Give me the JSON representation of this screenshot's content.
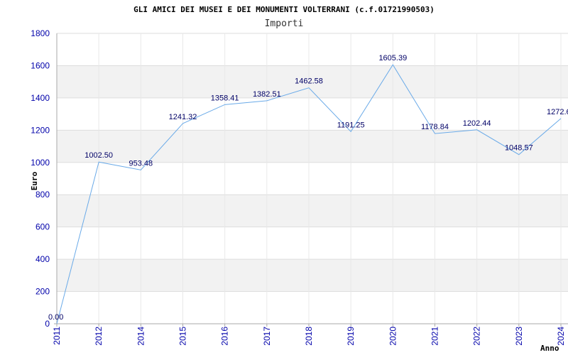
{
  "chart_data": {
    "type": "line",
    "title": "GLI AMICI DEI MUSEI E DEI MONUMENTI VOLTERRANI (c.f.01721990503)",
    "subtitle": "Importi",
    "xlabel": "Anno",
    "ylabel": "Euro",
    "ylim": [
      0,
      1800
    ],
    "yticks": [
      0,
      200,
      400,
      600,
      800,
      1000,
      1200,
      1400,
      1600,
      1800
    ],
    "grid": true,
    "categories": [
      "2011",
      "2012",
      "2014",
      "2015",
      "2016",
      "2017",
      "2018",
      "2019",
      "2020",
      "2021",
      "2022",
      "2023",
      "2024"
    ],
    "values": [
      0.0,
      1002.5,
      953.48,
      1241.32,
      1358.41,
      1382.51,
      1462.58,
      1191.25,
      1605.39,
      1178.84,
      1202.44,
      1048.57,
      1272.6
    ],
    "labels": [
      "0.00",
      "1002.50",
      "953.48",
      "1241.32",
      "1358.41",
      "1382.51",
      "1462.58",
      "1191.25",
      "1605.39",
      "1178.84",
      "1202.44",
      "1048.57",
      "1272.6"
    ],
    "line_color": "#6aaae8",
    "band_color": "#f2f2f2"
  }
}
